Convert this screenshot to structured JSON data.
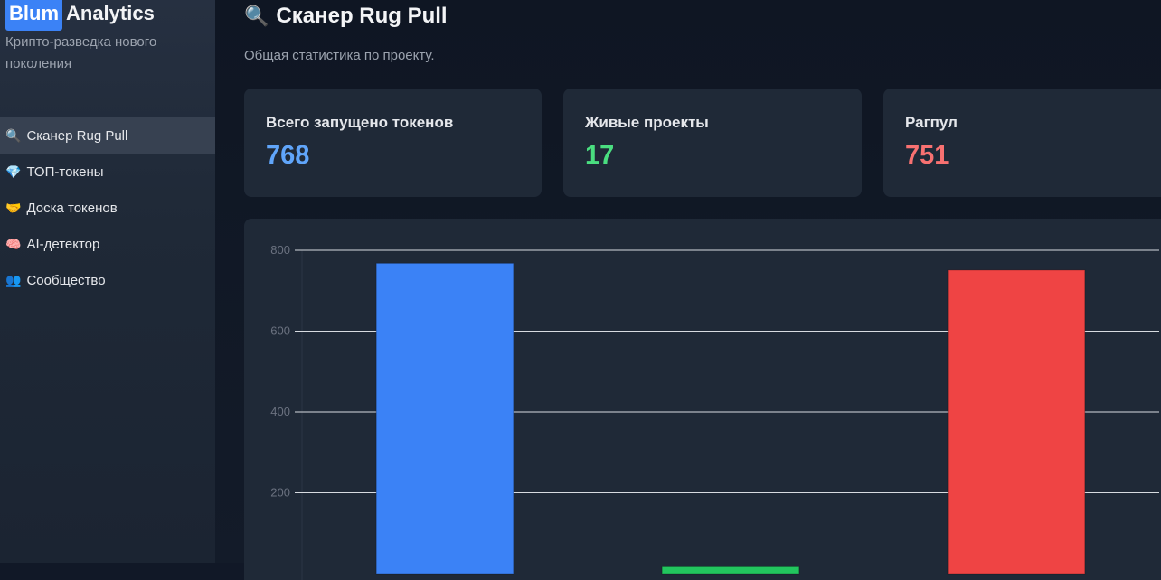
{
  "app": {
    "brand_highlight": "Blum",
    "brand_rest": "Analytics",
    "tagline": "Крипто-разведка нового поколения"
  },
  "sidebar": {
    "items": [
      {
        "icon": "magnifier-icon",
        "glyph": "🔍",
        "label": "Сканер Rug Pull",
        "active": true
      },
      {
        "icon": "gem-icon",
        "glyph": "💎",
        "label": "ТОП-токены",
        "active": false
      },
      {
        "icon": "handshake-icon",
        "glyph": "🤝",
        "label": "Доска токенов",
        "active": false
      },
      {
        "icon": "brain-icon",
        "glyph": "🧠",
        "label": "AI-детектор",
        "active": false
      },
      {
        "icon": "people-icon",
        "glyph": "👥",
        "label": "Сообщество",
        "active": false
      }
    ]
  },
  "page": {
    "title_glyph": "🔍",
    "title": "Сканер Rug Pull",
    "subtitle": "Общая статистика по проекту."
  },
  "stats": [
    {
      "label": "Всего запущено токенов",
      "value": "768",
      "color": "#60a5fa"
    },
    {
      "label": "Живые проекты",
      "value": "17",
      "color": "#4ade80"
    },
    {
      "label": "Рагпул",
      "value": "751",
      "color": "#f87171"
    }
  ],
  "chart_data": {
    "type": "bar",
    "categories": [
      "",
      "",
      ""
    ],
    "values": [
      768,
      17,
      751
    ],
    "colors": [
      "#3b82f6",
      "#22c55e",
      "#ef4444"
    ],
    "yticks": [
      200,
      400,
      600,
      800
    ],
    "ylim": [
      0,
      800
    ],
    "grid": true,
    "title": "",
    "xlabel": "",
    "ylabel": ""
  }
}
